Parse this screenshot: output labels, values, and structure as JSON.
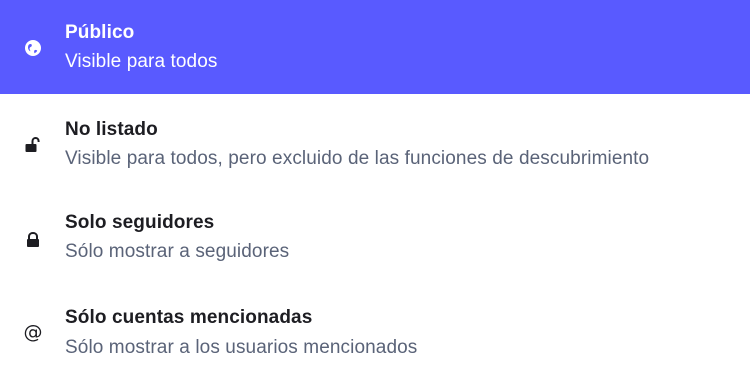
{
  "theme": {
    "accent": "#595aff"
  },
  "options": [
    {
      "icon": "globe-icon",
      "title": "Público",
      "description": "Visible para todos",
      "selected": true
    },
    {
      "icon": "unlock-icon",
      "title": "No listado",
      "description": "Visible para todos, pero excluido de las funciones de descubrimiento",
      "selected": false
    },
    {
      "icon": "lock-icon",
      "title": "Solo seguidores",
      "description": "Sólo mostrar a seguidores",
      "selected": false
    },
    {
      "icon": "at-icon",
      "title": "Sólo cuentas mencionadas",
      "description": "Sólo mostrar a los usuarios mencionados",
      "selected": false
    }
  ]
}
